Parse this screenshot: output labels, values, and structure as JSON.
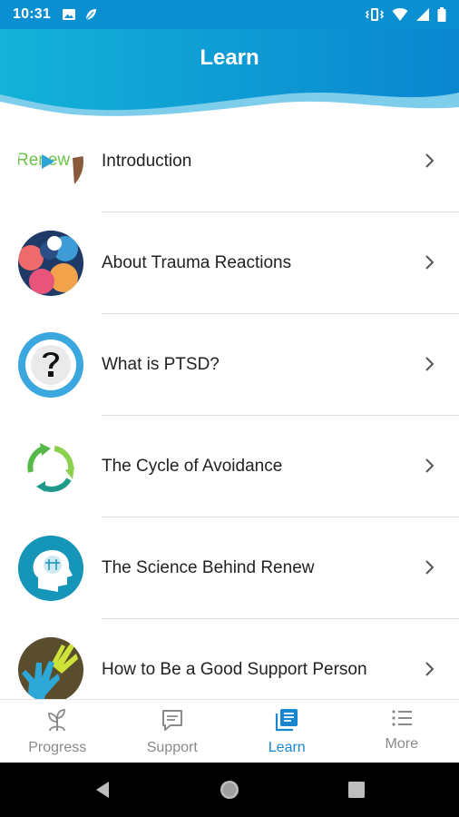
{
  "status_bar": {
    "time": "10:31",
    "left_icons": [
      "image-icon",
      "leaf-icon"
    ],
    "right_icons": [
      "vibrate-icon",
      "wifi-icon",
      "signal-icon",
      "battery-icon"
    ]
  },
  "header": {
    "title": "Learn",
    "colors": {
      "primary": "#0a8fd0",
      "wave_light": "#6cc6ea"
    }
  },
  "list": {
    "items": [
      {
        "label": "Introduction",
        "thumb": "renew-video-thumb"
      },
      {
        "label": "About Trauma Reactions",
        "thumb": "trauma-faces-thumb"
      },
      {
        "label": "What is PTSD?",
        "thumb": "question-bubble-thumb"
      },
      {
        "label": "The Cycle of Avoidance",
        "thumb": "cycle-arrows-thumb"
      },
      {
        "label": "The Science Behind Renew",
        "thumb": "brain-head-thumb"
      },
      {
        "label": "How to Be a Good Support Person",
        "thumb": "hands-thumb"
      }
    ],
    "intro_thumb_text": "Renew"
  },
  "bottom_nav": {
    "items": [
      {
        "label": "Progress",
        "icon": "sprout-icon",
        "active": false
      },
      {
        "label": "Support",
        "icon": "chat-icon",
        "active": false
      },
      {
        "label": "Learn",
        "icon": "book-list-icon",
        "active": true
      },
      {
        "label": "More",
        "icon": "menu-list-icon",
        "active": false
      }
    ],
    "colors": {
      "active": "#1a86d0",
      "inactive": "#8a8a8a"
    }
  }
}
